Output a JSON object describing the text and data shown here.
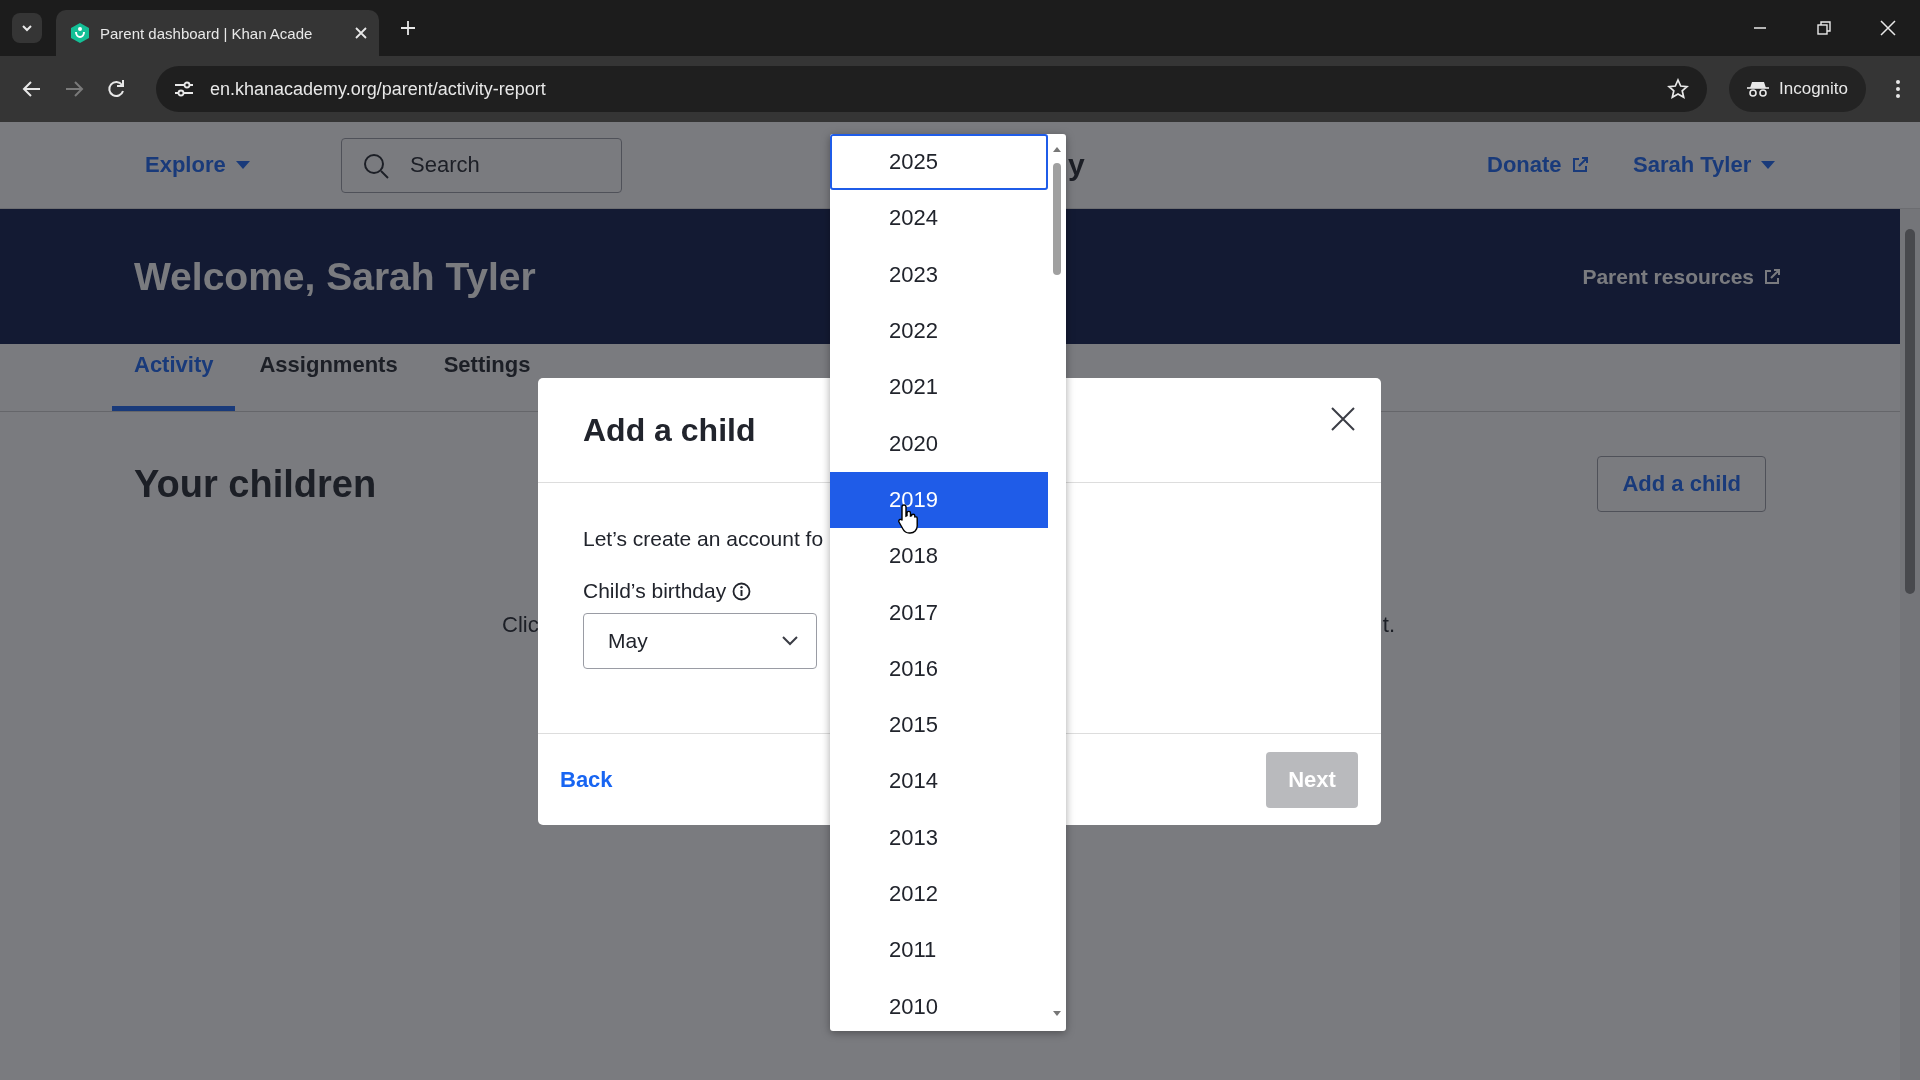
{
  "browser": {
    "tab": {
      "title": "Parent dashboard | Khan Acade"
    },
    "url": "en.khanacademy.org/parent/activity-report",
    "incognito": "Incognito"
  },
  "site_header": {
    "explore": "Explore",
    "search": {
      "placeholder": "Search"
    },
    "logo_partial": "y",
    "donate": "Donate",
    "user": "Sarah Tyler"
  },
  "banner": {
    "welcome": "Welcome, Sarah Tyler",
    "parent_resources": "Parent resources"
  },
  "tabs": [
    {
      "label": "Activity",
      "selected": true
    },
    {
      "label": "Assignments",
      "selected": false
    },
    {
      "label": "Settings",
      "selected": false
    }
  ],
  "content": {
    "heading": "Your children",
    "add_button": "Add a child",
    "partial_texts": [
      "Clic",
      "t."
    ]
  },
  "modal": {
    "title": "Add a child",
    "intro": "Let’s create an account fo",
    "birthday_label": "Child’s birthday",
    "month": {
      "value": "May"
    },
    "back": "Back",
    "next": {
      "label": "Next",
      "disabled": true
    }
  },
  "year_dropdown": {
    "options": [
      {
        "label": "2025",
        "selected": false,
        "focused": true
      },
      {
        "label": "2024",
        "selected": false,
        "focused": false
      },
      {
        "label": "2023",
        "selected": false,
        "focused": false
      },
      {
        "label": "2022",
        "selected": false,
        "focused": false
      },
      {
        "label": "2021",
        "selected": false,
        "focused": false
      },
      {
        "label": "2020",
        "selected": false,
        "focused": false
      },
      {
        "label": "2019",
        "selected": true,
        "focused": false
      },
      {
        "label": "2018",
        "selected": false,
        "focused": false
      },
      {
        "label": "2017",
        "selected": false,
        "focused": false
      },
      {
        "label": "2016",
        "selected": false,
        "focused": false
      },
      {
        "label": "2015",
        "selected": false,
        "focused": false
      },
      {
        "label": "2014",
        "selected": false,
        "focused": false
      },
      {
        "label": "2013",
        "selected": false,
        "focused": false
      },
      {
        "label": "2012",
        "selected": false,
        "focused": false
      },
      {
        "label": "2011",
        "selected": false,
        "focused": false
      },
      {
        "label": "2010",
        "selected": false,
        "focused": false
      }
    ]
  }
}
